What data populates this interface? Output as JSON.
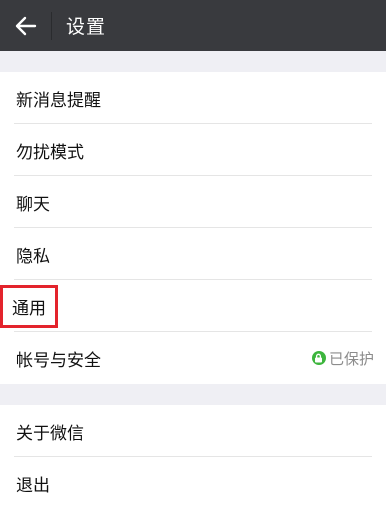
{
  "header": {
    "back_icon": "arrow-left-icon",
    "title": "设置"
  },
  "groups": [
    {
      "items": [
        {
          "label": "新消息提醒"
        },
        {
          "label": "勿扰模式"
        },
        {
          "label": "聊天"
        },
        {
          "label": "隐私"
        },
        {
          "label": "通用",
          "highlighted": true
        },
        {
          "label": "帐号与安全",
          "status_text": "已保护",
          "status_icon": "lock-icon",
          "status_color": "#3db53d"
        }
      ]
    },
    {
      "items": [
        {
          "label": "关于微信"
        },
        {
          "label": "退出"
        }
      ]
    }
  ],
  "colors": {
    "topbar": "#393a3e",
    "highlight_box": "#e3232c",
    "background": "#efeff4"
  }
}
